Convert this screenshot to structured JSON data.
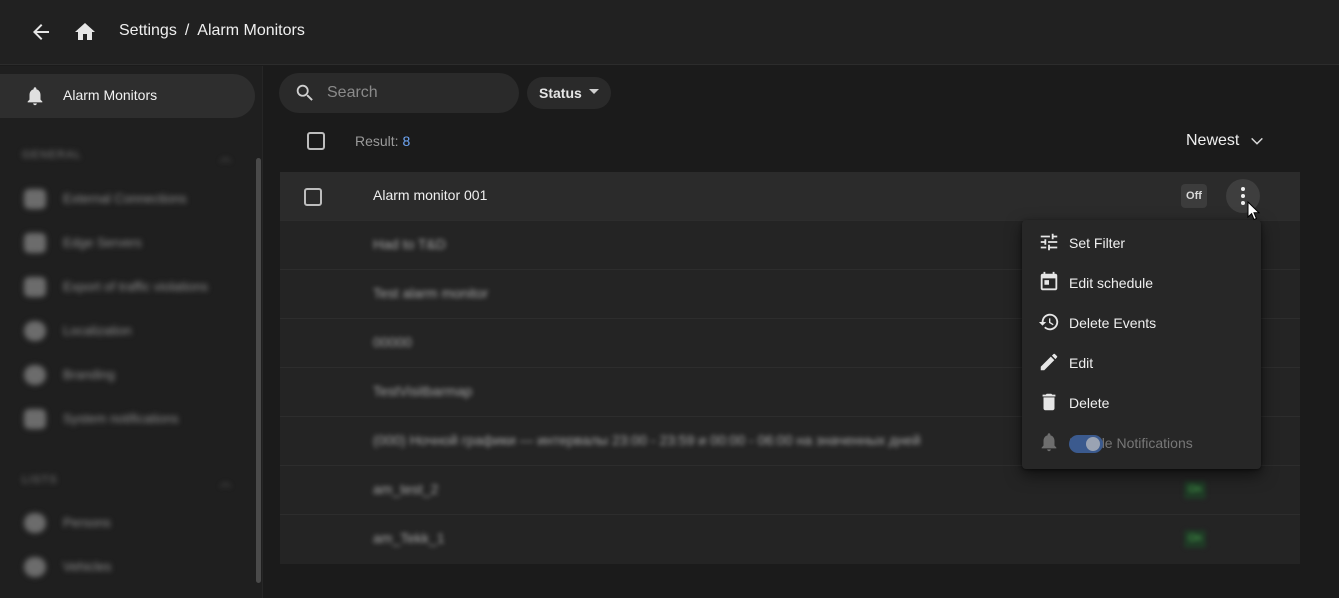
{
  "topbar": {
    "breadcrumb_root": "Settings",
    "breadcrumb_sep": "/",
    "breadcrumb_current": "Alarm Monitors"
  },
  "sidebar": {
    "active_item": "Alarm Monitors",
    "groups": [
      {
        "title": "General",
        "items": [
          "External Connections",
          "Edge Servers",
          "Export of traffic violations",
          "Localization",
          "Branding",
          "System notifications"
        ]
      },
      {
        "title": "Lists",
        "items": [
          "Persons",
          "Vehicles"
        ]
      }
    ]
  },
  "toolbar": {
    "search_placeholder": "Search",
    "status_filter": "Status"
  },
  "list_header": {
    "result_label": "Result:",
    "result_count": "8",
    "sort_label": "Newest"
  },
  "rows": [
    {
      "name": "Alarm monitor 001",
      "status": "Off"
    },
    {
      "name": "Had to T&D",
      "status": ""
    },
    {
      "name": "Test alarm monitor",
      "status": ""
    },
    {
      "name": "00000",
      "status": ""
    },
    {
      "name": "TestVisitbarmap",
      "status": ""
    },
    {
      "name": "(000) Ночной графики — интервалы 23:00 - 23:59 и 00:00 - 06:00 на значенных дней",
      "status": ""
    },
    {
      "name": "am_test_2",
      "status": "On"
    },
    {
      "name": "am_Tekk_1",
      "status": "On"
    }
  ],
  "context_menu": {
    "items": [
      {
        "label": "Set Filter",
        "icon": "tune-icon"
      },
      {
        "label": "Edit schedule",
        "icon": "calendar-icon"
      },
      {
        "label": "Delete Events",
        "icon": "history-icon"
      },
      {
        "label": "Edit",
        "icon": "pencil-icon"
      },
      {
        "label": "Delete",
        "icon": "trash-icon"
      },
      {
        "label": "Enable Notifications",
        "icon": "bell-icon",
        "disabled": true,
        "toggle_on": true
      }
    ]
  },
  "colors": {
    "background": "#1b1b1b",
    "accent": "#6ea6f5",
    "status_on": "#4caf50"
  }
}
